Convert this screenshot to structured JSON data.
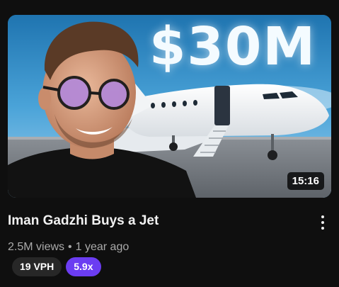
{
  "video": {
    "title": "Iman Gadzhi Buys a Jet",
    "thumbnail_text": "$30M",
    "duration": "15:16",
    "views": "2.5M views",
    "separator": "•",
    "age": "1 year ago"
  },
  "badges": {
    "vph": "19 VPH",
    "multiplier": "5.9x"
  },
  "icons": {
    "more": "more-vert-icon"
  },
  "colors": {
    "background": "#0f0f0f",
    "multiplier_badge": "#6b3df2",
    "vph_badge": "#272727"
  }
}
